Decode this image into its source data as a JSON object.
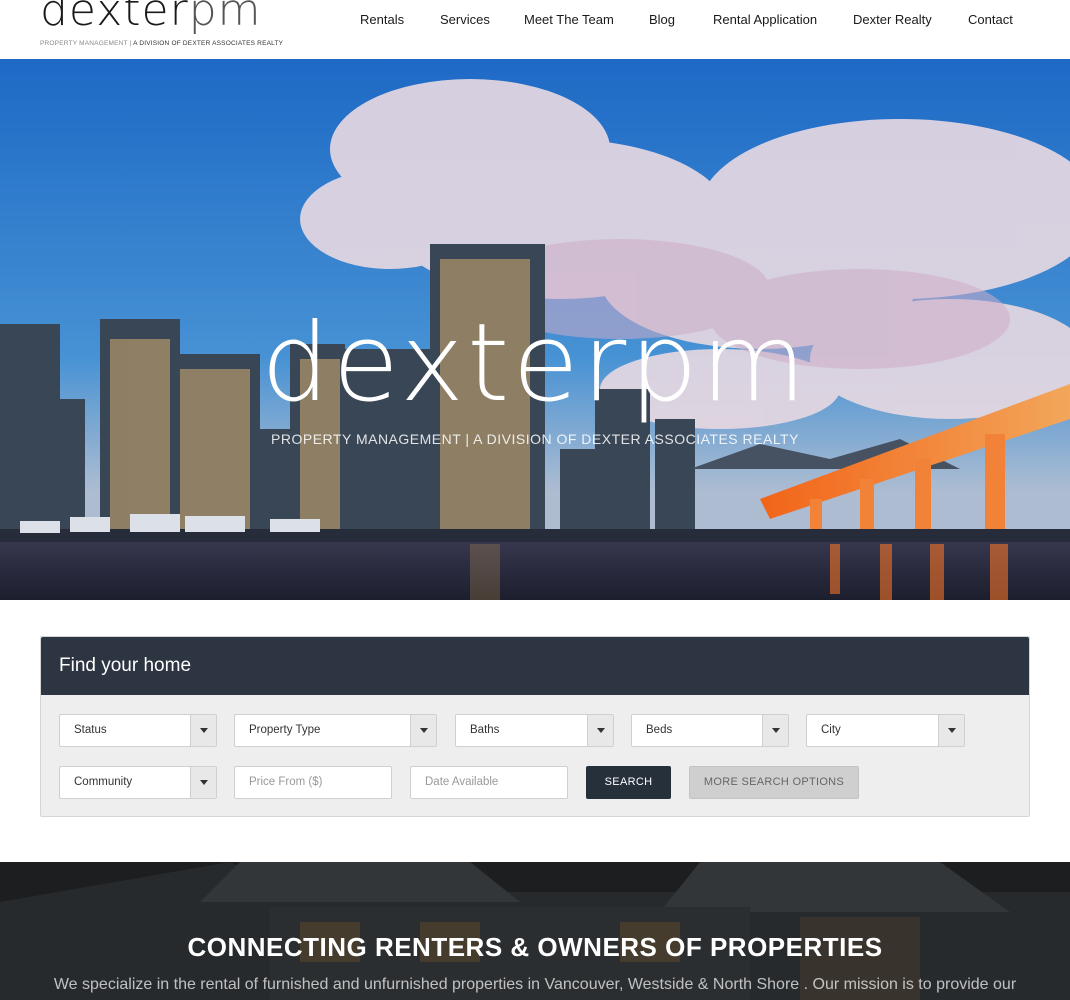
{
  "header": {
    "logo": {
      "word_main": "dexter",
      "word_accent": "pm",
      "tag_light": "PROPERTY MANAGEMENT | ",
      "tag_dark": "A DIVISION OF DEXTER ASSOCIATES REALTY"
    },
    "nav": [
      {
        "label": "Rentals"
      },
      {
        "label": "Services"
      },
      {
        "label": "Meet The Team"
      },
      {
        "label": "Blog"
      },
      {
        "label": "Rental Application"
      },
      {
        "label": "Dexter Realty"
      },
      {
        "label": "Contact"
      }
    ]
  },
  "hero": {
    "title": "dexterpm",
    "subtitle": "PROPERTY MANAGEMENT | A DIVISION OF DEXTER ASSOCIATES REALTY"
  },
  "search": {
    "title": "Find your home",
    "selects": [
      {
        "label": "Status"
      },
      {
        "label": "Property Type"
      },
      {
        "label": "Baths"
      },
      {
        "label": "Beds"
      },
      {
        "label": "City"
      },
      {
        "label": "Community"
      }
    ],
    "price_from_placeholder": "Price From ($)",
    "date_available_placeholder": "Date Available",
    "search_label": "SEARCH",
    "more_label": "MORE SEARCH OPTIONS"
  },
  "intro": {
    "title": "CONNECTING RENTERS & OWNERS OF PROPERTIES",
    "text": "We specialize in the rental of furnished and unfurnished properties in Vancouver, Westside & North Shore . Our mission is to provide our"
  },
  "colors": {
    "panel_header": "#2c3541",
    "search_button": "#26303b",
    "more_button": "#cfcfcf"
  }
}
